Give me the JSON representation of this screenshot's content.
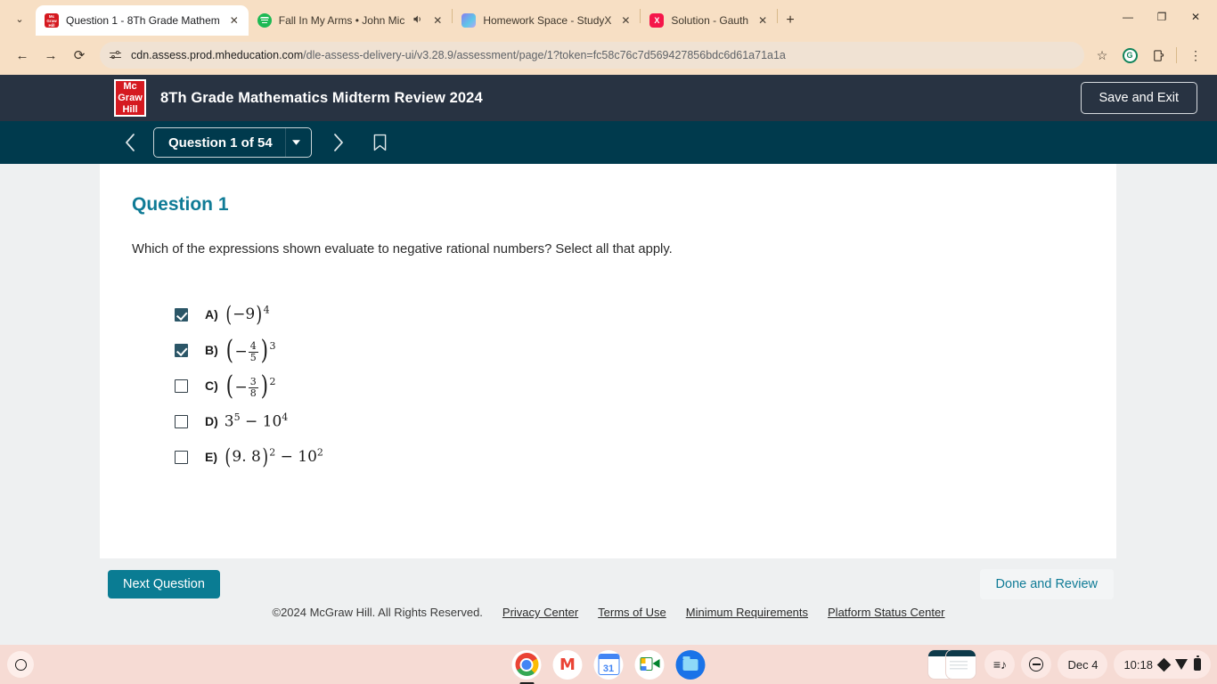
{
  "browser": {
    "tabs": [
      {
        "title": "Question 1 - 8Th Grade Mathem",
        "favicon": "mcgraw-hill-icon",
        "active": true,
        "audio": false
      },
      {
        "title": "Fall In My Arms • John Mic",
        "favicon": "spotify-icon",
        "active": false,
        "audio": true
      },
      {
        "title": "Homework Space - StudyX",
        "favicon": "studyx-icon",
        "active": false,
        "audio": false
      },
      {
        "title": "Solution - Gauth",
        "favicon": "gauth-icon",
        "active": false,
        "audio": false
      }
    ],
    "url_domain": "cdn.assess.prod.mheducation.com",
    "url_path": "/dle-assess-delivery-ui/v3.28.9/assessment/page/1?token=fc58c76c7d569427856bdc6d61a71a1a",
    "new_tab_label": "+",
    "close_label": "✕",
    "minimize_label": "—",
    "maximize_label": "❐",
    "window_close_label": "✕",
    "back_label": "←",
    "forward_label": "→",
    "reload_label": "⟳",
    "bookmark_star": "☆",
    "grammarly_label": "G",
    "extensions_label": "⬚",
    "menu_label": "⋮",
    "tab_search_label": "⌄",
    "audio_label": "🔊"
  },
  "assessment": {
    "logo_line1": "Mc",
    "logo_line2": "Graw",
    "logo_line3": "Hill",
    "title": "8Th Grade Mathematics Midterm Review 2024",
    "save_exit_label": "Save and Exit",
    "nav": {
      "prev_label": "‹",
      "next_label": "›",
      "question_selector": "Question 1 of 54",
      "caret": "▼",
      "bookmark_icon": "bookmark-icon"
    },
    "question": {
      "heading": "Question 1",
      "prompt": "Which of the expressions shown evaluate to negative rational numbers? Select all that apply.",
      "options": [
        {
          "letter": "A)",
          "expression": "(−9)⁴",
          "checked": true
        },
        {
          "letter": "B)",
          "expression": "(−4/5)³",
          "checked": true
        },
        {
          "letter": "C)",
          "expression": "(−3/8)²",
          "checked": false
        },
        {
          "letter": "D)",
          "expression": "3⁵ − 10⁴",
          "checked": false
        },
        {
          "letter": "E)",
          "expression": "(9.8)² − 10²",
          "checked": false
        }
      ]
    },
    "next_question_label": "Next Question",
    "done_review_label": "Done and Review",
    "footer": {
      "copyright": "©2024 McGraw Hill. All Rights Reserved.",
      "links": [
        "Privacy Center",
        "Terms of Use",
        "Minimum Requirements",
        "Platform Status Center"
      ]
    },
    "colors": {
      "header_bg": "#283342",
      "nav_bg": "#003a4d",
      "accent": "#0f7b96",
      "next_button": "#0a7c93",
      "checkbox_checked": "#2b5667",
      "logo_red": "#d51920"
    }
  },
  "taskbar": {
    "launcher": "launcher-icon",
    "apps": [
      {
        "name": "chrome-icon",
        "running": true
      },
      {
        "name": "gmail-icon",
        "running": false
      },
      {
        "name": "calendar-icon",
        "running": false,
        "day": "31"
      },
      {
        "name": "google-meet-icon",
        "running": false
      },
      {
        "name": "files-icon",
        "running": false
      }
    ],
    "music_icon": "music-playlist-icon",
    "dnd_icon": "do-not-disturb-icon",
    "date": "Dec 4",
    "time": "10:18"
  }
}
